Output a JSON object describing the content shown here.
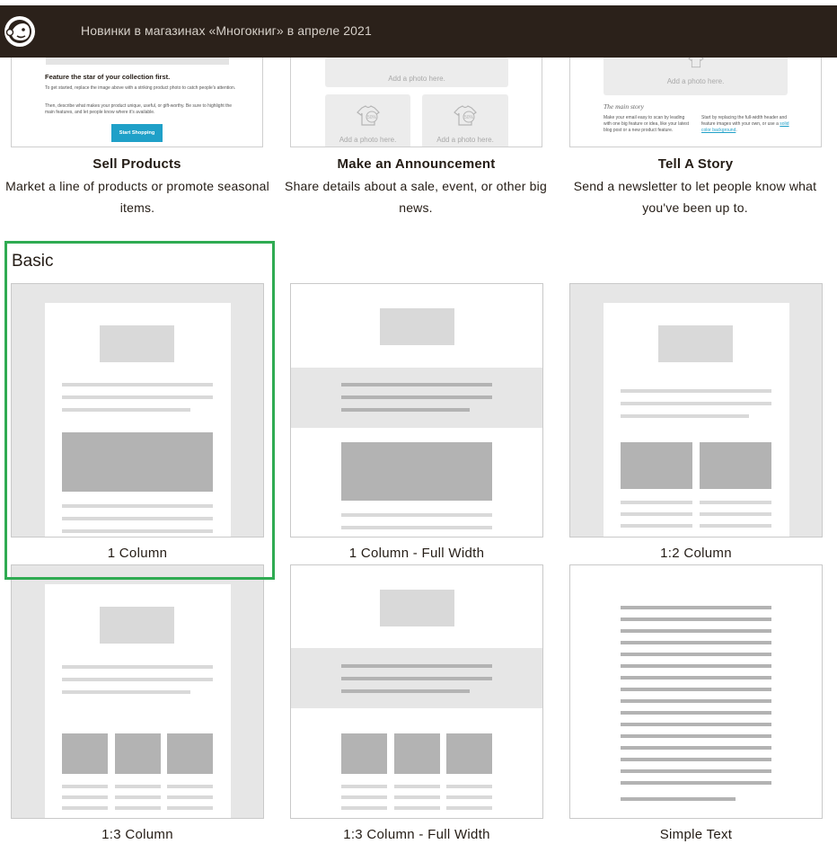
{
  "header": {
    "title": "Новинки в магазинах «Многокниг» в апреле 2021",
    "logo_icon": "mailchimp-freddie-icon"
  },
  "featured": [
    {
      "title": "Sell Products",
      "description": "Market a line of products or promote seasonal items.",
      "thumb": {
        "heading": "Feature the star of your collection first.",
        "para1": "To get started, replace the image above with a striking product photo to catch people's attention.",
        "para2": "Then, describe what makes your product unique, useful, or gift-worthy. Be sure to highlight the main features, and let people know where it's available.",
        "button": "Start Shopping"
      }
    },
    {
      "title": "Make an Announcement",
      "description": "Share details about a sale, event, or other big news.",
      "thumb": {
        "photo_text": "Add a photo here.",
        "badge": "50%"
      }
    },
    {
      "title": "Tell A Story",
      "description": "Send a newsletter to let people know what you've been up to.",
      "thumb": {
        "photo_text": "Add a photo here.",
        "main_story": "The main story",
        "col1": "Make your email easy to scan by leading with one big feature or idea, like your latest blog post or a new product feature.",
        "col2": "Start by replacing the full-width header and feature images with your own, or use a",
        "col2_link": "solid color background",
        "col2_end": "."
      }
    }
  ],
  "basic": {
    "label": "Basic",
    "templates": [
      {
        "name": "1 Column"
      },
      {
        "name": "1 Column - Full Width"
      },
      {
        "name": "1:2 Column"
      },
      {
        "name": "1:3 Column"
      },
      {
        "name": "1:3 Column - Full Width"
      },
      {
        "name": "Simple Text"
      }
    ]
  },
  "colors": {
    "header_bg": "#2b211a",
    "selection_highlight": "#2fab52",
    "button_accent": "#1fa0c8"
  }
}
